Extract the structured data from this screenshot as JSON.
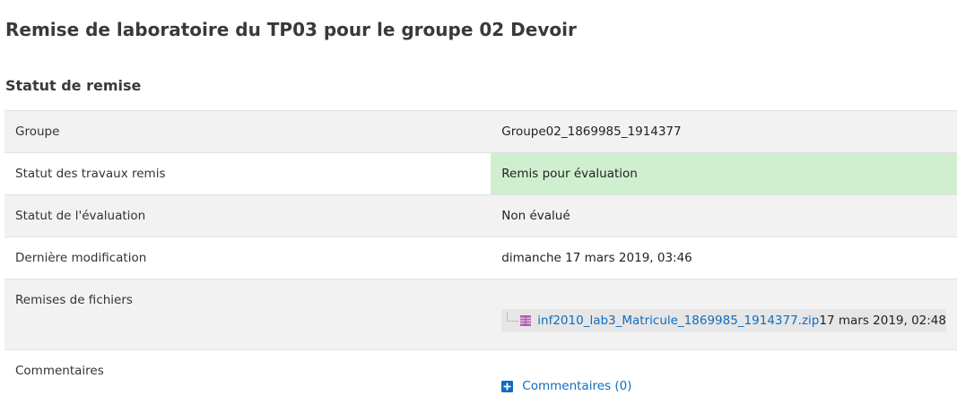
{
  "page": {
    "title": "Remise de laboratoire du TP03 pour le groupe 02 Devoir",
    "section_title": "Statut de remise"
  },
  "status": {
    "rows": [
      {
        "label": "Groupe",
        "value": "Groupe02_1869985_1914377"
      },
      {
        "label": "Statut des travaux remis",
        "value": "Remis pour évaluation"
      },
      {
        "label": "Statut de l'évaluation",
        "value": "Non évalué"
      },
      {
        "label": "Dernière modification",
        "value": "dimanche 17 mars 2019, 03:46"
      },
      {
        "label": "Remises de fichiers"
      },
      {
        "label": "Commentaires"
      }
    ],
    "file": {
      "name": "inf2010_lab3_Matricule_1869985_1914377.zip",
      "date": "17 mars 2019, 02:48",
      "icon": "archive-file-icon"
    },
    "comments": {
      "link_label": "Commentaires (0)",
      "icon": "plus-square-icon"
    }
  },
  "colors": {
    "submitted_bg": "#cfefcf",
    "link": "#0f6cbf",
    "stripe": "#f2f2f2"
  }
}
